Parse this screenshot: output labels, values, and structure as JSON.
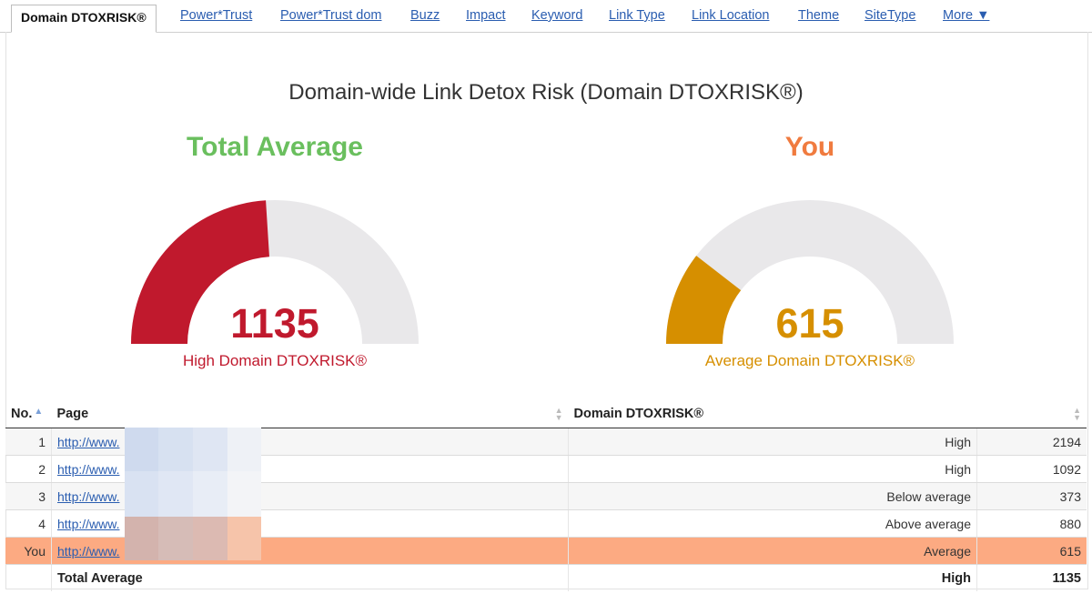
{
  "tabs": [
    {
      "label": "Domain DTOXRISK®",
      "active": true
    },
    {
      "label": "Power*Trust"
    },
    {
      "label": "Power*Trust dom"
    },
    {
      "label": "Buzz"
    },
    {
      "label": "Impact"
    },
    {
      "label": "Keyword"
    },
    {
      "label": "Link Type"
    },
    {
      "label": "Link Location"
    },
    {
      "label": "Theme"
    },
    {
      "label": "SiteType"
    },
    {
      "label": "More ▼"
    }
  ],
  "chart_title": "Domain-wide Link Detox Risk (Domain DTOXRISK®)",
  "gauges": {
    "total": {
      "heading": "Total Average",
      "value": "1135",
      "label": "High Domain DTOXRISK®",
      "fraction": 0.48,
      "heading_color": "#6abf5e",
      "color": "#c0192d"
    },
    "you": {
      "heading": "You",
      "value": "615",
      "label": "Average Domain DTOXRISK®",
      "fraction": 0.21,
      "heading_color": "#f07b3f",
      "color": "#d68f00"
    }
  },
  "table": {
    "headers": {
      "no": "No.",
      "page": "Page",
      "risk": "Domain DTOXRISK®"
    },
    "rows": [
      {
        "no": "1",
        "page": "http://www.",
        "risk": "High",
        "value": "2194"
      },
      {
        "no": "2",
        "page": "http://www.",
        "risk": "High",
        "value": "1092"
      },
      {
        "no": "3",
        "page": "http://www.",
        "risk": "Below average",
        "value": "373"
      },
      {
        "no": "4",
        "page": "http://www.",
        "risk": "Above average",
        "value": "880"
      },
      {
        "no": "You",
        "page": "http://www.",
        "risk": "Average",
        "value": "615"
      }
    ],
    "total": {
      "label": "Total Average",
      "risk": "High",
      "value": "1135"
    }
  }
}
